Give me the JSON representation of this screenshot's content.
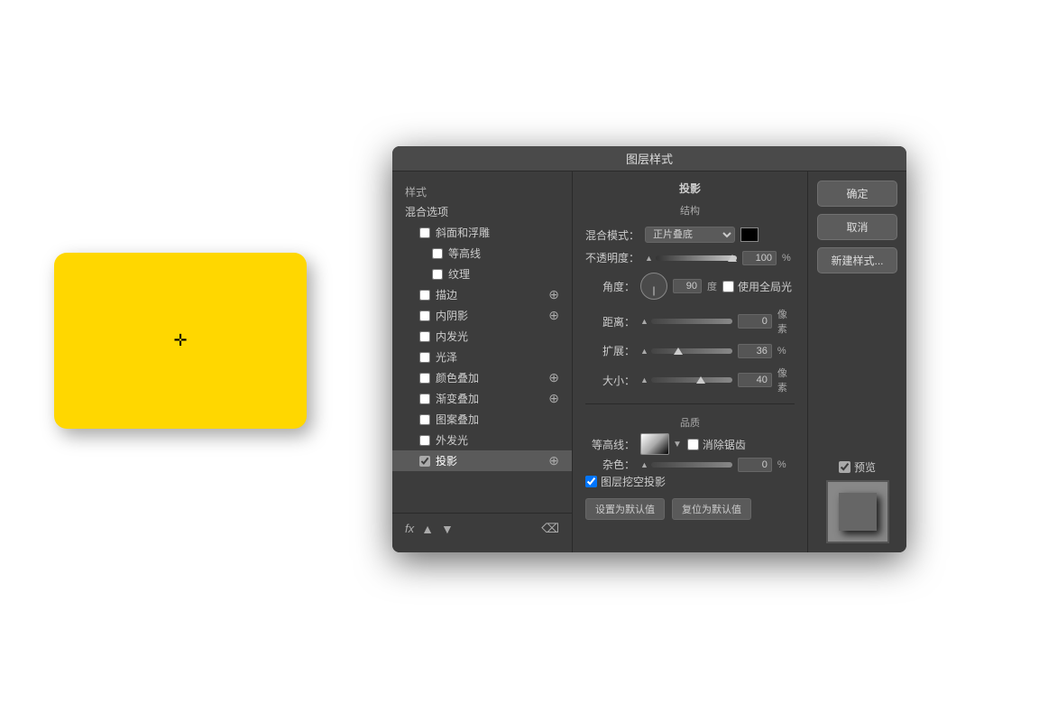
{
  "canvas": {
    "card_color": "#FFD700",
    "card_shadow": "rgba(0,0,0,0.35)"
  },
  "dialog": {
    "title": "图层样式",
    "left_panel": {
      "section_label": "样式",
      "items": [
        {
          "label": "混合选项",
          "checked": false,
          "indent": 0,
          "active": false,
          "has_add": false
        },
        {
          "label": "斜面和浮雕",
          "checked": false,
          "indent": 1,
          "active": false,
          "has_add": false
        },
        {
          "label": "等高线",
          "checked": false,
          "indent": 2,
          "active": false,
          "has_add": false
        },
        {
          "label": "纹理",
          "checked": false,
          "indent": 2,
          "active": false,
          "has_add": false
        },
        {
          "label": "描边",
          "checked": false,
          "indent": 1,
          "active": false,
          "has_add": true
        },
        {
          "label": "内阴影",
          "checked": false,
          "indent": 1,
          "active": false,
          "has_add": true
        },
        {
          "label": "内发光",
          "checked": false,
          "indent": 1,
          "active": false,
          "has_add": false
        },
        {
          "label": "光泽",
          "checked": false,
          "indent": 1,
          "active": false,
          "has_add": false
        },
        {
          "label": "颜色叠加",
          "checked": false,
          "indent": 1,
          "active": false,
          "has_add": true
        },
        {
          "label": "渐变叠加",
          "checked": false,
          "indent": 1,
          "active": false,
          "has_add": true
        },
        {
          "label": "图案叠加",
          "checked": false,
          "indent": 1,
          "active": false,
          "has_add": false
        },
        {
          "label": "外发光",
          "checked": false,
          "indent": 1,
          "active": false,
          "has_add": false
        },
        {
          "label": "投影",
          "checked": true,
          "indent": 1,
          "active": true,
          "has_add": true
        }
      ],
      "footer": {
        "fx_label": "fx",
        "up_arrow": "▲",
        "down_arrow": "▼",
        "trash": "🗑"
      }
    },
    "right_panel": {
      "section_title": "投影",
      "sub_title": "结构",
      "blend_mode_label": "混合模式：",
      "blend_mode_value": "正片叠底",
      "opacity_label": "不透明度：",
      "opacity_value": "100",
      "opacity_unit": "%",
      "angle_label": "角度：",
      "angle_value": "90",
      "angle_unit": "度",
      "use_global_light_label": "使用全局光",
      "distance_label": "距离：",
      "distance_value": "0",
      "distance_unit": "像素",
      "spread_label": "扩展：",
      "spread_value": "36",
      "spread_unit": "%",
      "size_label": "大小：",
      "size_value": "40",
      "size_unit": "像素",
      "quality_title": "品质",
      "contour_label": "等高线：",
      "antialias_label": "消除锯齿",
      "noise_label": "杂色：",
      "noise_value": "0",
      "noise_unit": "%",
      "ko_label": "图层挖空投影",
      "set_default_btn": "设置为默认值",
      "reset_default_btn": "复位为默认值"
    },
    "buttons_panel": {
      "ok_label": "确定",
      "cancel_label": "取消",
      "new_style_label": "新建样式...",
      "preview_label": "预览"
    }
  }
}
